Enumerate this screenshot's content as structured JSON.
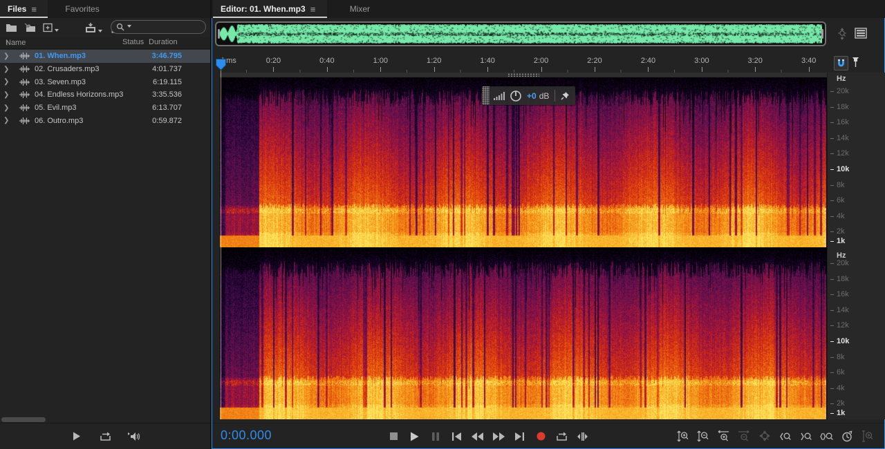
{
  "accent": {
    "selection_blue": "#3f9bef",
    "time_blue": "#2f8ceb",
    "focus_border": "#2e8ceb",
    "record_red": "#dd3a2d",
    "snap_blue": "#3f9bef"
  },
  "files_panel": {
    "tabs": [
      {
        "label": "Files"
      },
      {
        "label": "Favorites"
      }
    ],
    "menu_icon": "≡",
    "toolbar_icons": [
      "open-file",
      "import-file",
      "new-content",
      "save",
      "delete",
      "search"
    ],
    "search_value": "",
    "columns": {
      "name": "Name",
      "sort": "↑",
      "status": "Status",
      "duration": "Duration"
    },
    "files": [
      {
        "name": "01. When.mp3",
        "status": "",
        "duration": "3:46.795",
        "selected": true
      },
      {
        "name": "02. Crusaders.mp3",
        "status": "",
        "duration": "4:01.737",
        "selected": false
      },
      {
        "name": "03. Seven.mp3",
        "status": "",
        "duration": "6:19.115",
        "selected": false
      },
      {
        "name": "04. Endless Horizons.mp3",
        "status": "",
        "duration": "3:35.536",
        "selected": false
      },
      {
        "name": "05. Evil.mp3",
        "status": "",
        "duration": "6:13.707",
        "selected": false
      },
      {
        "name": "06. Outro.mp3",
        "status": "",
        "duration": "0:59.872",
        "selected": false
      }
    ],
    "preview_buttons": [
      "play",
      "loop",
      "auto-play"
    ]
  },
  "editor": {
    "tabs": [
      {
        "label": "Editor: 01. When.mp3"
      },
      {
        "label": "Mixer"
      }
    ],
    "overview_icons": [
      "zoom-out-full",
      "track-list"
    ],
    "ruler": {
      "unit": "hms",
      "ticks": [
        "0:20",
        "0:40",
        "1:00",
        "1:20",
        "1:40",
        "2:00",
        "2:20",
        "2:40",
        "3:00",
        "3:20",
        "3:40"
      ],
      "snap_enabled": true
    },
    "freq_axis": {
      "unit": "Hz",
      "labels": [
        "20k",
        "18k",
        "16k",
        "14k",
        "12k",
        "10k",
        "8k",
        "6k",
        "4k",
        "2k",
        "1k"
      ],
      "highlighted": [
        "10k",
        "1k"
      ]
    },
    "hud": {
      "gain": "+0",
      "unit": "dB"
    },
    "time_display": "0:00.000",
    "transport_buttons": [
      {
        "name": "stop",
        "enabled": true
      },
      {
        "name": "play",
        "enabled": true
      },
      {
        "name": "pause",
        "enabled": false
      },
      {
        "name": "skip-to-start",
        "enabled": true
      },
      {
        "name": "rewind",
        "enabled": true
      },
      {
        "name": "fast-forward",
        "enabled": true
      },
      {
        "name": "skip-to-end",
        "enabled": true
      },
      {
        "name": "record",
        "enabled": true
      },
      {
        "name": "loop-playback",
        "enabled": true
      },
      {
        "name": "skip-selection",
        "enabled": true
      }
    ],
    "zoom_buttons": [
      {
        "name": "zoom-in-amplitude",
        "enabled": true
      },
      {
        "name": "zoom-out-amplitude",
        "enabled": true
      },
      {
        "name": "zoom-in-time",
        "enabled": true
      },
      {
        "name": "zoom-out-time",
        "enabled": false
      },
      {
        "name": "zoom-out-full",
        "enabled": false
      },
      {
        "name": "zoom-in-at-in-point",
        "enabled": true
      },
      {
        "name": "zoom-in-at-out-point",
        "enabled": true
      },
      {
        "name": "zoom-to-selection",
        "enabled": true
      },
      {
        "name": "zoom-reset",
        "enabled": true
      },
      {
        "name": "zoom-amplitude-full",
        "enabled": false
      }
    ]
  },
  "overview_waveform": {
    "wave_color": "#76e8a9",
    "background": "#0e0e0e"
  },
  "spectrogram": {
    "type": "heatmap",
    "channels": 2,
    "time_range_s": [
      0,
      226.795
    ],
    "freq_labels_hz": [
      "20k",
      "18k",
      "16k",
      "14k",
      "12k",
      "10k",
      "8k",
      "6k",
      "4k",
      "2k",
      "1k"
    ],
    "intro_quiet_fraction": 0.065,
    "palette": [
      "#000000",
      "#1c0330",
      "#55104f",
      "#9c1240",
      "#d82f0e",
      "#ee7011",
      "#f9a81f",
      "#ffe45e"
    ]
  }
}
